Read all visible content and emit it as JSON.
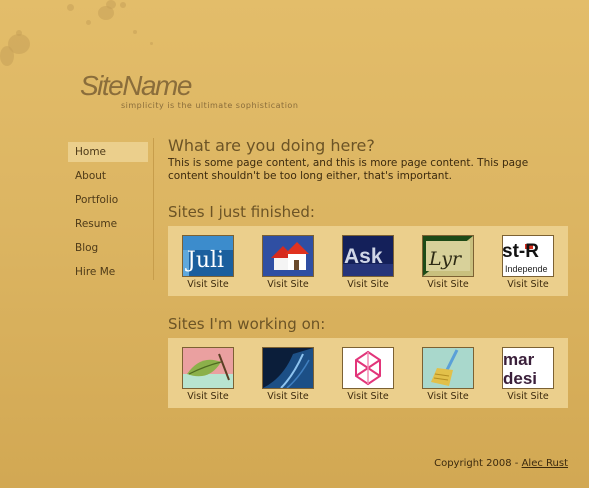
{
  "header": {
    "site_name": "SiteName",
    "tagline": "simplicity is the ultimate sophistication"
  },
  "nav": {
    "items": [
      {
        "label": "Home",
        "active": true
      },
      {
        "label": "About"
      },
      {
        "label": "Portfolio"
      },
      {
        "label": "Resume"
      },
      {
        "label": "Blog"
      },
      {
        "label": "Hire Me"
      }
    ]
  },
  "main": {
    "heading": "What are you doing here?",
    "paragraph": "This is some page content, and this is more page content. This page content shouldn't be too long either, that's important."
  },
  "finished": {
    "heading": "Sites I just finished:",
    "sites": [
      {
        "thumb_text": "Juli",
        "icon": "juli-thumbnail-icon",
        "link_label": "Visit Site"
      },
      {
        "thumb_text": "",
        "icon": "houses-thumbnail-icon",
        "link_label": "Visit Site"
      },
      {
        "thumb_text": "Ask",
        "icon": "ask-thumbnail-icon",
        "link_label": "Visit Site"
      },
      {
        "thumb_text": "Lyr",
        "icon": "lyr-thumbnail-icon",
        "link_label": "Visit Site"
      },
      {
        "thumb_text": "st-R",
        "thumb_subtext": "Independe",
        "icon": "independent-thumbnail-icon",
        "link_label": "Visit Site"
      }
    ]
  },
  "working": {
    "heading": "Sites I'm working on:",
    "sites": [
      {
        "icon": "leaf-thumbnail-icon",
        "link_label": "Visit Site"
      },
      {
        "icon": "blue-wave-thumbnail-icon",
        "link_label": "Visit Site"
      },
      {
        "icon": "pink-lattice-thumbnail-icon",
        "link_label": "Visit Site"
      },
      {
        "icon": "broom-thumbnail-icon",
        "link_label": "Visit Site"
      },
      {
        "thumb_text": "mar",
        "thumb_subtext": "desi",
        "icon": "mardesi-thumbnail-icon",
        "link_label": "Visit Site"
      }
    ]
  },
  "footer": {
    "copyright": "Copyright 2008 - ",
    "author": "Alec Rust"
  },
  "colors": {
    "background": "#dcb562",
    "panel": "#ebcf8c",
    "text": "#3c2a0e",
    "heading": "#6c5426"
  }
}
